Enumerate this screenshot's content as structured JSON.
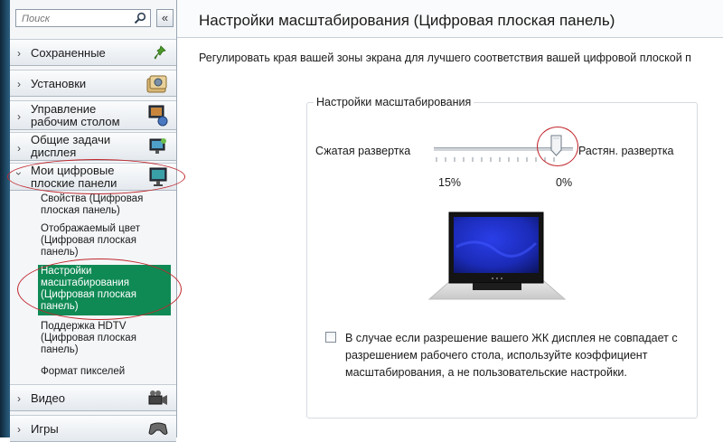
{
  "search": {
    "placeholder": "Поиск"
  },
  "sidebar": {
    "collapse_label": "«",
    "categories": [
      {
        "label": "Сохраненные",
        "icon": "pin-icon"
      },
      {
        "label": "Установки",
        "icon": "settings-folder-icon"
      },
      {
        "label": "Управление рабочим столом",
        "icon": "desktop-manage-icon"
      },
      {
        "label": "Общие задачи дисплея",
        "icon": "display-tasks-icon"
      },
      {
        "label": "Мои цифровые плоские панели",
        "icon": "flat-panel-icon"
      },
      {
        "label": "Видео",
        "icon": "video-camera-icon"
      },
      {
        "label": "Игры",
        "icon": "gamepad-icon"
      }
    ],
    "subitems": [
      "Свойства (Цифровая плоская панель)",
      "Отображаемый цвет (Цифровая плоская панель)",
      "Настройки масштабирования (Цифровая плоская панель)",
      "Поддержка HDTV (Цифровая плоская панель)",
      "Формат пикселей"
    ],
    "selected_index": 2
  },
  "main": {
    "title": "Настройки масштабирования (Цифровая плоская панель)",
    "description": "Регулировать края вашей зоны экрана для лучшего соответствия вашей цифровой плоской п",
    "group_title": "Настройки масштабирования",
    "slider": {
      "left_label": "Сжатая развертка",
      "right_label": "Растян. развертка",
      "left_value": "15%",
      "right_value": "0%",
      "position": 0.85
    },
    "checkbox": {
      "checked": false,
      "label": "В случае если разрешение вашего ЖК дисплея не совпадает с разрешением рабочего стола, используйте коэффициент масштабирования, а не пользовательские настройки."
    }
  },
  "colors": {
    "selected_bg": "#108a55",
    "highlight_ring": "#c0272d",
    "screen_blue": "#1a2fd0"
  }
}
